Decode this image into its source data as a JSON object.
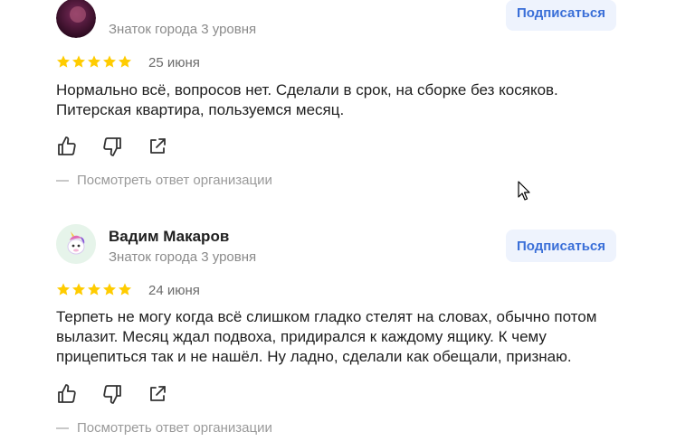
{
  "reviews": [
    {
      "author": "",
      "level": "Знаток города 3 уровня",
      "subscribe_label": "Подписаться",
      "rating": 5,
      "date": "25 июня",
      "text": "Нормально всё, вопросов нет. Сделали в срок, на сборке без косяков. Питерская квартира, пользуемся месяц.",
      "answer_link": "Посмотреть ответ организации"
    },
    {
      "author": "Вадим Макаров",
      "level": "Знаток города 3 уровня",
      "subscribe_label": "Подписаться",
      "rating": 5,
      "date": "24 июня",
      "text": "Терпеть не могу когда всё слишком гладко стелят на словах, обычно потом вылазит. Месяц ждал подвоха, придирался к каждому ящику. К чему прицепиться так и не нашёл. Ну ладно, сделали как обещали, признаю.",
      "answer_link": "Посмотреть ответ организации"
    }
  ],
  "colors": {
    "star": "#fc0",
    "subscribe_bg": "#eef3fd",
    "subscribe_text": "#3a6fd8"
  },
  "icons": [
    "like-icon",
    "dislike-icon",
    "share-icon",
    "mouse-cursor-icon"
  ]
}
